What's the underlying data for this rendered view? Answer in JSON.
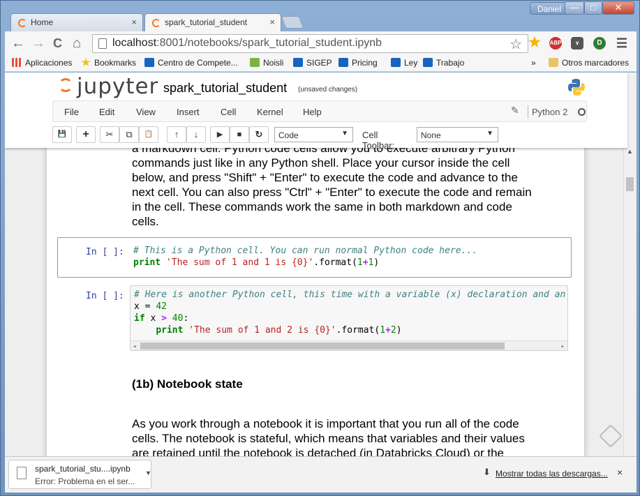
{
  "window": {
    "user": "Daniel",
    "controls": {
      "minimize": "—",
      "maximize": "□",
      "close": "✕"
    }
  },
  "tabs": [
    {
      "label": "Home",
      "close": "×"
    },
    {
      "label": "spark_tutorial_student",
      "close": "×"
    }
  ],
  "address_bar": {
    "host": "localhost",
    "path": ":8001/notebooks/spark_tutorial_student.ipynb"
  },
  "nav_icons": {
    "back": "←",
    "forward": "→",
    "reload": "C",
    "home": "⌂",
    "star": "☆"
  },
  "extensions": [
    "bookmark-star",
    "adblock",
    "pocket",
    "ad-ext",
    "menu"
  ],
  "extension_labels": {
    "adblock": "ABP",
    "ad-ext": "D",
    "menu": "☰"
  },
  "bookmarks": [
    {
      "label": "Aplicaciones",
      "color": "#e84c3d"
    },
    {
      "label": "Bookmarks",
      "color": "#f4c20d"
    },
    {
      "label": "Centro de Compete...",
      "color": "#1565c0"
    },
    {
      "label": "Noisli",
      "color": "#7cb342"
    },
    {
      "label": "SIGEP",
      "color": "#1565c0"
    },
    {
      "label": "Pricing",
      "color": "#1565c0"
    },
    {
      "label": "Ley",
      "color": "#1565c0"
    },
    {
      "label": "Trabajo",
      "color": "#1565c0"
    }
  ],
  "bookmarks_more": "»",
  "other_bookmarks": "Otros marcadores",
  "jupyter": {
    "logo": "jupyter",
    "notebook_name": "spark_tutorial_student",
    "save_status": "(unsaved changes)",
    "menus": [
      "File",
      "Edit",
      "View",
      "Insert",
      "Cell",
      "Kernel",
      "Help"
    ],
    "kernel_name": "Python 2",
    "toolbar": {
      "icons": [
        "save",
        "add",
        "cut",
        "copy",
        "paste",
        "move-up",
        "move-down",
        "run",
        "stop",
        "restart"
      ],
      "icon_glyphs": {
        "save": "💾",
        "add": "+",
        "cut": "✂",
        "copy": "⧉",
        "paste": "📋",
        "move-up": "↑",
        "move-down": "↓",
        "run": "▶",
        "stop": "■",
        "restart": "↻"
      },
      "cell_type": "Code",
      "cell_toolbar_label": "Cell Toolbar:",
      "cell_toolbar_value": "None"
    }
  },
  "markdown_top": [
    "a markdown cell. Python code cells allow you to execute arbitrary Python",
    "commands just like in any Python shell. Place your cursor inside the cell",
    "below, and press \"Shift\" + \"Enter\" to execute the code and advance to the",
    "next cell. You can also press \"Ctrl\" + \"Enter\" to execute the code and remain",
    "in the cell. These commands work the same in both markdown and code",
    "cells."
  ],
  "cells": [
    {
      "prompt": "In [ ]:"
    },
    {
      "prompt": "In [ ]:"
    }
  ],
  "section_heading": "(1b) Notebook state",
  "markdown_bottom": [
    "As you work through a notebook it is important that you run all of the code",
    "cells. The notebook is stateful, which means that variables and their values",
    "are retained until the notebook is detached (in Databricks Cloud) or the"
  ],
  "downloads": {
    "file_name": "spark_tutorial_stu....ipynb",
    "status": "Error: Problema en el ser...",
    "show_all": "Mostrar todas las descargas...",
    "close": "×"
  }
}
